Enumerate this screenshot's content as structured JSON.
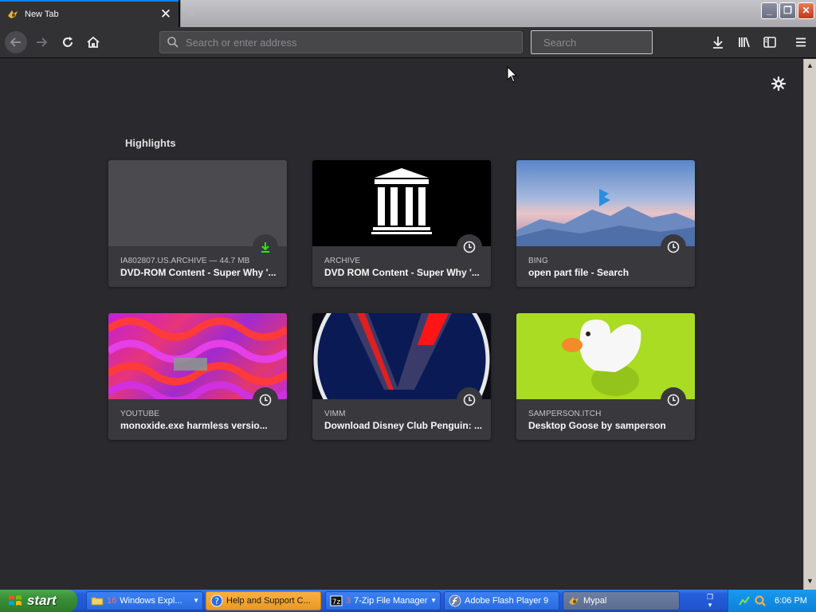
{
  "browser": {
    "tab": {
      "title": "New Tab",
      "close": "✕"
    },
    "new_tab": "+",
    "window_controls": {
      "minimize": "_",
      "maximize": "❐",
      "close": "✕"
    },
    "urlbar": {
      "placeholder": "Search or enter address",
      "value": ""
    },
    "searchbar": {
      "placeholder": "Search",
      "value": ""
    }
  },
  "highlights": {
    "title": "Highlights",
    "cards": [
      {
        "meta": "IA802807.US.ARCHIVE — 44.7 MB",
        "title": "DVD-ROM Content - Super Why '...",
        "badge": "download-icon"
      },
      {
        "meta": "ARCHIVE",
        "title": "DVD ROM Content - Super Why '...",
        "badge": "clock-icon"
      },
      {
        "meta": "BING",
        "title": "open part file - Search",
        "badge": "clock-icon"
      },
      {
        "meta": "YOUTUBE",
        "title": "monoxide.exe harmless versio...",
        "badge": "clock-icon"
      },
      {
        "meta": "VIMM",
        "title": "Download Disney Club Penguin: ...",
        "badge": "clock-icon"
      },
      {
        "meta": "SAMPERSON.ITCH",
        "title": "Desktop Goose by samperson",
        "badge": "clock-icon"
      }
    ]
  },
  "taskbar": {
    "start": "start",
    "tasks": [
      {
        "count": "16",
        "label": "Windows Expl..."
      },
      {
        "count": "",
        "label": "Help and Support C..."
      },
      {
        "count": "3",
        "label": "7-Zip File Manager"
      },
      {
        "count": "",
        "label": "Adobe Flash Player 9"
      },
      {
        "count": "",
        "label": "Mypal"
      }
    ],
    "clock": "6:06 PM"
  },
  "colors": {
    "accent": "#0a84ff",
    "background": "#2a2a2e",
    "card": "#38383d",
    "download_green": "#30e60b"
  }
}
